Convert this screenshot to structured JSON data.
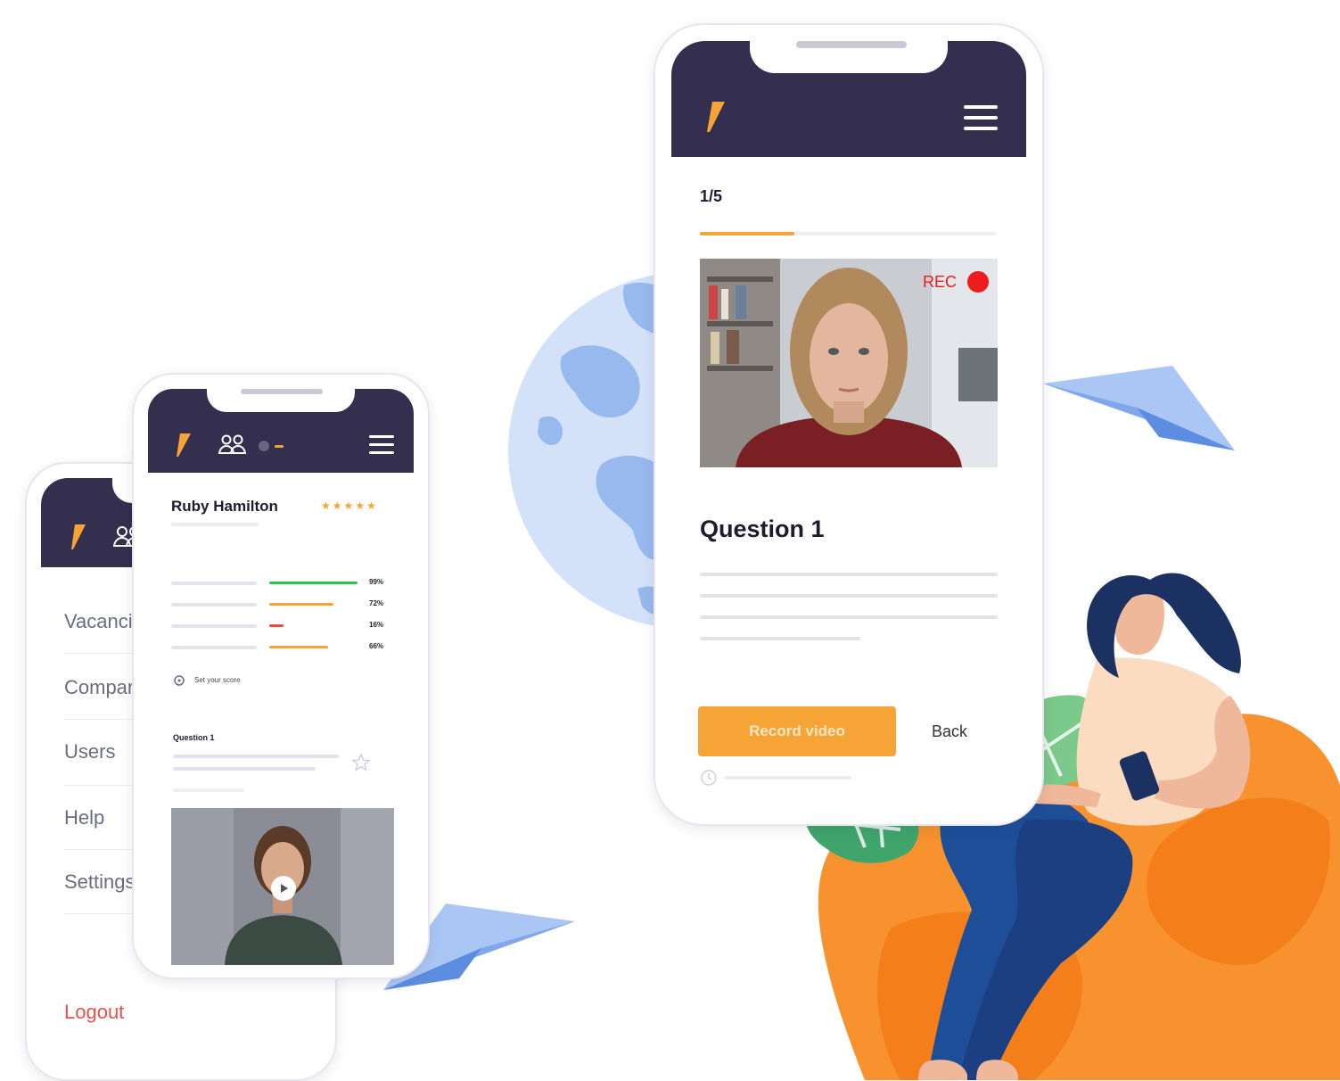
{
  "brand": {
    "navy": "#352f4f",
    "accent": "#f6a436",
    "rec_red": "#ee1c1c",
    "logout_red": "#e8504a",
    "logo_icon": "lightning-slash-icon"
  },
  "menu_phone": {
    "items": [
      {
        "label": "Vacancie"
      },
      {
        "label": "Compani"
      },
      {
        "label": "Users"
      },
      {
        "label": "Help"
      },
      {
        "label": "Settings"
      }
    ],
    "logout_label": "Logout"
  },
  "candidate_phone": {
    "candidate_name": "Ruby Hamilton",
    "rating": "★★★★★",
    "skills": [
      {
        "percent_label": "99%",
        "value": 0.99,
        "color": "#2bc44a"
      },
      {
        "percent_label": "72%",
        "value": 0.72,
        "color": "#f6a436"
      },
      {
        "percent_label": "16%",
        "value": 0.16,
        "color": "#e84a3c"
      },
      {
        "percent_label": "66%",
        "value": 0.66,
        "color": "#f6a436"
      }
    ],
    "set_score_label": "Set your score",
    "question_label": "Question 1"
  },
  "interview_phone": {
    "progress_label": "1/5",
    "progress_value": 0.32,
    "rec_label": "REC",
    "question_title": "Question 1",
    "record_button_label": "Record video",
    "back_label": "Back"
  }
}
